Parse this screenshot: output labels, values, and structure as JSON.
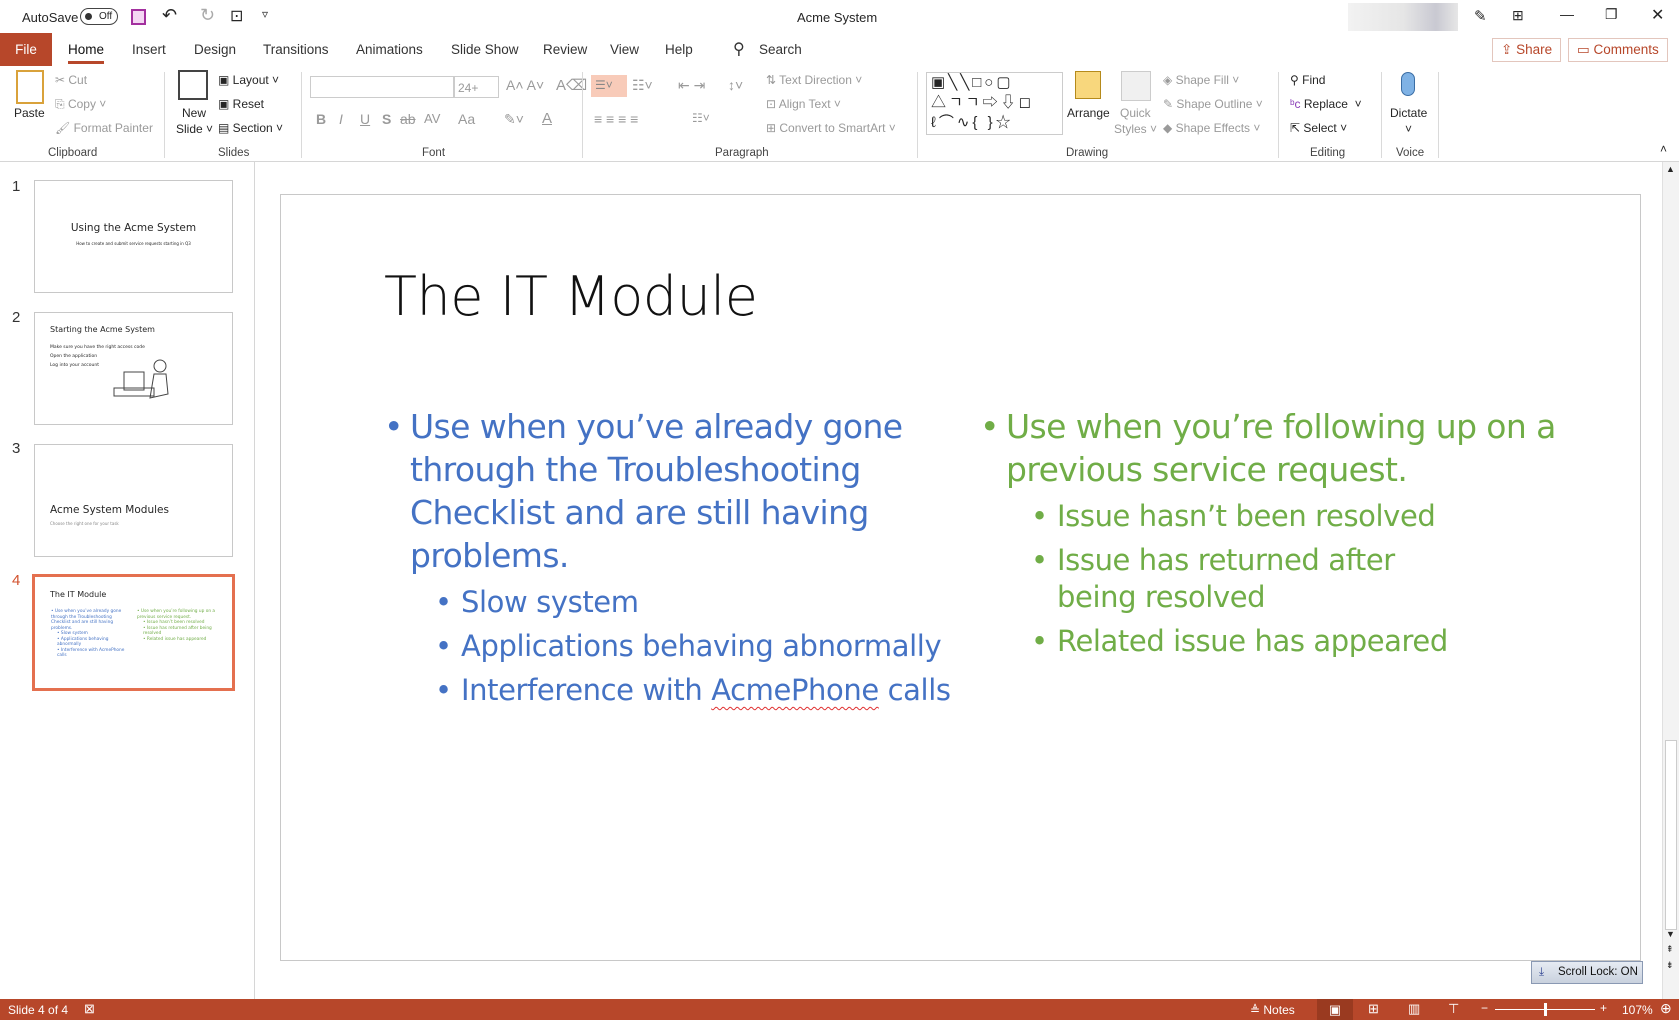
{
  "titlebar": {
    "autosave_label": "AutoSave",
    "autosave_state": "Off",
    "title": "Acme System"
  },
  "tabs": [
    {
      "label": "File"
    },
    {
      "label": "Home",
      "active": true
    },
    {
      "label": "Insert"
    },
    {
      "label": "Design"
    },
    {
      "label": "Transitions"
    },
    {
      "label": "Animations"
    },
    {
      "label": "Slide Show"
    },
    {
      "label": "Review"
    },
    {
      "label": "View"
    },
    {
      "label": "Help"
    }
  ],
  "search": {
    "label": "Search"
  },
  "share_label": "Share",
  "comments_label": "Comments",
  "ribbon": {
    "clipboard": {
      "paste": "Paste",
      "cut": "Cut",
      "copy": "Copy",
      "format_painter": "Format Painter",
      "group": "Clipboard"
    },
    "slides": {
      "new_slide_1": "New",
      "new_slide_2": "Slide",
      "layout": "Layout",
      "reset": "Reset",
      "section": "Section",
      "group": "Slides"
    },
    "font": {
      "font_name": "",
      "font_size": "24+",
      "bold": "B",
      "italic": "I",
      "underline": "U",
      "shadow": "S",
      "strike": "ab",
      "spacing": "AV",
      "case": "Aa",
      "color": "A",
      "group": "Font"
    },
    "paragraph": {
      "text_direction": "Text Direction",
      "align_text": "Align Text",
      "smartart": "Convert to SmartArt",
      "group": "Paragraph"
    },
    "drawing": {
      "arrange": "Arrange",
      "quick_styles_1": "Quick",
      "quick_styles_2": "Styles",
      "shape_fill": "Shape Fill",
      "shape_outline": "Shape Outline",
      "shape_effects": "Shape Effects",
      "group": "Drawing"
    },
    "editing": {
      "find": "Find",
      "replace": "Replace",
      "select": "Select",
      "group": "Editing"
    },
    "voice": {
      "dictate": "Dictate",
      "group": "Voice"
    }
  },
  "thumbnails": [
    {
      "num": "1",
      "title": "Using the Acme System",
      "subtitle": "How to create and submit service requests starting in Q3"
    },
    {
      "num": "2",
      "title": "Starting the Acme System",
      "bullets": [
        "Make sure you have the right access code",
        "Open the application",
        "Log into your account"
      ]
    },
    {
      "num": "3",
      "title": "Acme System Modules",
      "subtitle": "Choose the right one for your task"
    },
    {
      "num": "4",
      "title": "The IT Module",
      "selected": true
    }
  ],
  "slide": {
    "title": "The IT Module",
    "left": {
      "bullet": "Use when you’ve already gone through the Troubleshooting Checklist and are still having problems.",
      "sub": [
        "Slow system",
        "Applications behaving abnormally"
      ],
      "sub3_pre": "Interference with ",
      "sub3_misspelled": "AcmePhone",
      "sub3_post": " calls",
      "color": "#4472C4"
    },
    "right": {
      "bullet": "Use when you’re following up on a previous service request.",
      "sub": [
        "Issue hasn’t been resolved",
        "Issue has returned after being resolved",
        "Related issue has appeared"
      ],
      "color": "#70AD47"
    }
  },
  "scroll_lock": "Scroll Lock: ON",
  "status": {
    "slide_info": "Slide 4 of 4",
    "notes": "Notes",
    "zoom": "107%",
    "accent": "#B7472A"
  }
}
